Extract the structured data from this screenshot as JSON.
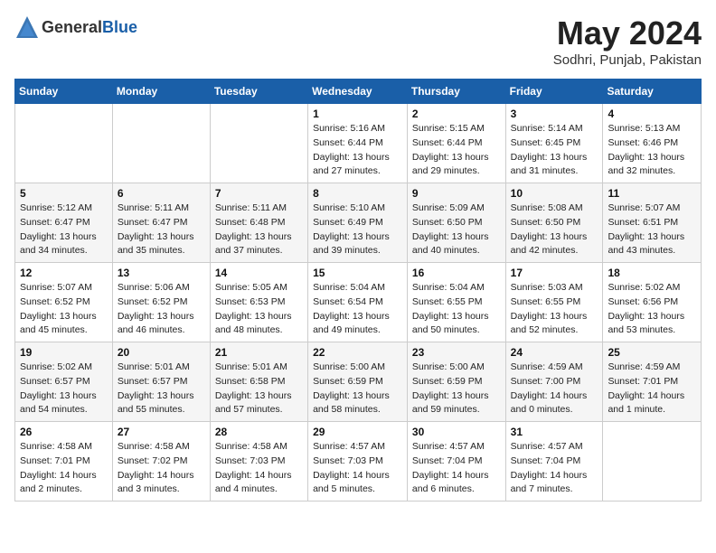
{
  "header": {
    "logo_general": "General",
    "logo_blue": "Blue",
    "month_year": "May 2024",
    "location": "Sodhri, Punjab, Pakistan"
  },
  "weekdays": [
    "Sunday",
    "Monday",
    "Tuesday",
    "Wednesday",
    "Thursday",
    "Friday",
    "Saturday"
  ],
  "weeks": [
    [
      {
        "day": "",
        "info": ""
      },
      {
        "day": "",
        "info": ""
      },
      {
        "day": "",
        "info": ""
      },
      {
        "day": "1",
        "info": "Sunrise: 5:16 AM\nSunset: 6:44 PM\nDaylight: 13 hours\nand 27 minutes."
      },
      {
        "day": "2",
        "info": "Sunrise: 5:15 AM\nSunset: 6:44 PM\nDaylight: 13 hours\nand 29 minutes."
      },
      {
        "day": "3",
        "info": "Sunrise: 5:14 AM\nSunset: 6:45 PM\nDaylight: 13 hours\nand 31 minutes."
      },
      {
        "day": "4",
        "info": "Sunrise: 5:13 AM\nSunset: 6:46 PM\nDaylight: 13 hours\nand 32 minutes."
      }
    ],
    [
      {
        "day": "5",
        "info": "Sunrise: 5:12 AM\nSunset: 6:47 PM\nDaylight: 13 hours\nand 34 minutes."
      },
      {
        "day": "6",
        "info": "Sunrise: 5:11 AM\nSunset: 6:47 PM\nDaylight: 13 hours\nand 35 minutes."
      },
      {
        "day": "7",
        "info": "Sunrise: 5:11 AM\nSunset: 6:48 PM\nDaylight: 13 hours\nand 37 minutes."
      },
      {
        "day": "8",
        "info": "Sunrise: 5:10 AM\nSunset: 6:49 PM\nDaylight: 13 hours\nand 39 minutes."
      },
      {
        "day": "9",
        "info": "Sunrise: 5:09 AM\nSunset: 6:50 PM\nDaylight: 13 hours\nand 40 minutes."
      },
      {
        "day": "10",
        "info": "Sunrise: 5:08 AM\nSunset: 6:50 PM\nDaylight: 13 hours\nand 42 minutes."
      },
      {
        "day": "11",
        "info": "Sunrise: 5:07 AM\nSunset: 6:51 PM\nDaylight: 13 hours\nand 43 minutes."
      }
    ],
    [
      {
        "day": "12",
        "info": "Sunrise: 5:07 AM\nSunset: 6:52 PM\nDaylight: 13 hours\nand 45 minutes."
      },
      {
        "day": "13",
        "info": "Sunrise: 5:06 AM\nSunset: 6:52 PM\nDaylight: 13 hours\nand 46 minutes."
      },
      {
        "day": "14",
        "info": "Sunrise: 5:05 AM\nSunset: 6:53 PM\nDaylight: 13 hours\nand 48 minutes."
      },
      {
        "day": "15",
        "info": "Sunrise: 5:04 AM\nSunset: 6:54 PM\nDaylight: 13 hours\nand 49 minutes."
      },
      {
        "day": "16",
        "info": "Sunrise: 5:04 AM\nSunset: 6:55 PM\nDaylight: 13 hours\nand 50 minutes."
      },
      {
        "day": "17",
        "info": "Sunrise: 5:03 AM\nSunset: 6:55 PM\nDaylight: 13 hours\nand 52 minutes."
      },
      {
        "day": "18",
        "info": "Sunrise: 5:02 AM\nSunset: 6:56 PM\nDaylight: 13 hours\nand 53 minutes."
      }
    ],
    [
      {
        "day": "19",
        "info": "Sunrise: 5:02 AM\nSunset: 6:57 PM\nDaylight: 13 hours\nand 54 minutes."
      },
      {
        "day": "20",
        "info": "Sunrise: 5:01 AM\nSunset: 6:57 PM\nDaylight: 13 hours\nand 55 minutes."
      },
      {
        "day": "21",
        "info": "Sunrise: 5:01 AM\nSunset: 6:58 PM\nDaylight: 13 hours\nand 57 minutes."
      },
      {
        "day": "22",
        "info": "Sunrise: 5:00 AM\nSunset: 6:59 PM\nDaylight: 13 hours\nand 58 minutes."
      },
      {
        "day": "23",
        "info": "Sunrise: 5:00 AM\nSunset: 6:59 PM\nDaylight: 13 hours\nand 59 minutes."
      },
      {
        "day": "24",
        "info": "Sunrise: 4:59 AM\nSunset: 7:00 PM\nDaylight: 14 hours\nand 0 minutes."
      },
      {
        "day": "25",
        "info": "Sunrise: 4:59 AM\nSunset: 7:01 PM\nDaylight: 14 hours\nand 1 minute."
      }
    ],
    [
      {
        "day": "26",
        "info": "Sunrise: 4:58 AM\nSunset: 7:01 PM\nDaylight: 14 hours\nand 2 minutes."
      },
      {
        "day": "27",
        "info": "Sunrise: 4:58 AM\nSunset: 7:02 PM\nDaylight: 14 hours\nand 3 minutes."
      },
      {
        "day": "28",
        "info": "Sunrise: 4:58 AM\nSunset: 7:03 PM\nDaylight: 14 hours\nand 4 minutes."
      },
      {
        "day": "29",
        "info": "Sunrise: 4:57 AM\nSunset: 7:03 PM\nDaylight: 14 hours\nand 5 minutes."
      },
      {
        "day": "30",
        "info": "Sunrise: 4:57 AM\nSunset: 7:04 PM\nDaylight: 14 hours\nand 6 minutes."
      },
      {
        "day": "31",
        "info": "Sunrise: 4:57 AM\nSunset: 7:04 PM\nDaylight: 14 hours\nand 7 minutes."
      },
      {
        "day": "",
        "info": ""
      }
    ]
  ]
}
